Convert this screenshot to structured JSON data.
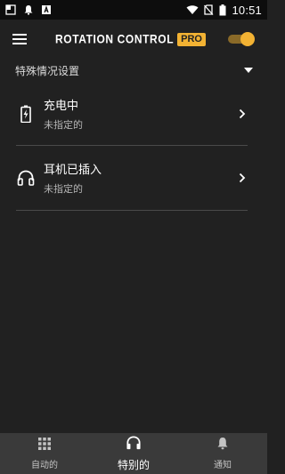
{
  "status_bar": {
    "time": "10:51",
    "left_icons": [
      "gallery-icon",
      "notification-bell-icon",
      "app-notification-icon"
    ],
    "right_icons": [
      "wifi-icon",
      "no-sim-icon",
      "battery-icon"
    ]
  },
  "app_bar": {
    "logo_text": "ROTATION CONTROL",
    "logo_badge": "PRO",
    "master_toggle_on": true,
    "accent_color": "#f2b233"
  },
  "section": {
    "title": "特殊情况设置",
    "expanded": true
  },
  "items": [
    {
      "icon": "battery-charging-icon",
      "title": "充电中",
      "subtitle": "未指定的"
    },
    {
      "icon": "headphones-icon",
      "title": "耳机已插入",
      "subtitle": "未指定的"
    }
  ],
  "bottom_nav": {
    "active": "special",
    "items": [
      {
        "id": "auto",
        "icon": "grid-icon",
        "label": "自动的"
      },
      {
        "id": "special",
        "icon": "headphones-icon",
        "label": "特别的"
      },
      {
        "id": "notify",
        "icon": "bell-icon",
        "label": "通知"
      }
    ]
  },
  "colors": {
    "background": "#212121",
    "status_bar": "#0d0d0d",
    "bottom_nav": "#3a3a3a",
    "divider": "#4a4a4a"
  }
}
